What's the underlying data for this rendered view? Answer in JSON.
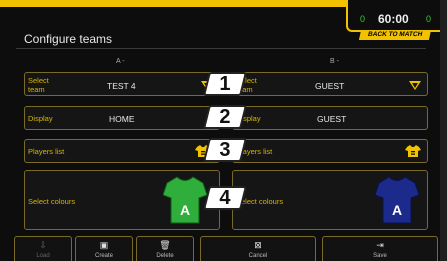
{
  "scoreboard": {
    "left_score": "0",
    "time": "60:00",
    "right_score": "0",
    "back_label": "BACK TO MATCH"
  },
  "page": {
    "title": "Configure teams"
  },
  "columns": {
    "left": "A -",
    "right": "B -"
  },
  "left": {
    "select_team_label": "Select team",
    "team_value": "TEST 4",
    "display_label": "Display",
    "display_value": "HOME",
    "players_label": "Players list",
    "colours_label": "Select colours",
    "shirt_letter": "A",
    "shirt_color": "#2fae3c"
  },
  "right": {
    "select_team_label": "Select team",
    "team_value": "GUEST",
    "display_label": "Display",
    "display_value": "GUEST",
    "players_label": "Players list",
    "colours_label": "Select colours",
    "shirt_letter": "A",
    "shirt_color": "#1c2a8c"
  },
  "badges": [
    "1",
    "2",
    "3",
    "4"
  ],
  "footer": {
    "buttons": [
      {
        "label": "Load",
        "icon": "load-icon",
        "glyph": "⇩",
        "enabled": false
      },
      {
        "label": "Create",
        "icon": "create-icon",
        "glyph": "▣",
        "enabled": true
      },
      {
        "label": "Delete",
        "icon": "trash-icon",
        "glyph": "🗑",
        "enabled": true
      },
      {
        "label": "Cancel",
        "icon": "cancel-icon",
        "glyph": "⊠",
        "enabled": true
      },
      {
        "label": "Save",
        "icon": "save-icon",
        "glyph": "⇥",
        "enabled": true
      }
    ]
  },
  "colors": {
    "accent": "#f2c200",
    "border": "#7a6a2a",
    "label": "#d8b400"
  }
}
